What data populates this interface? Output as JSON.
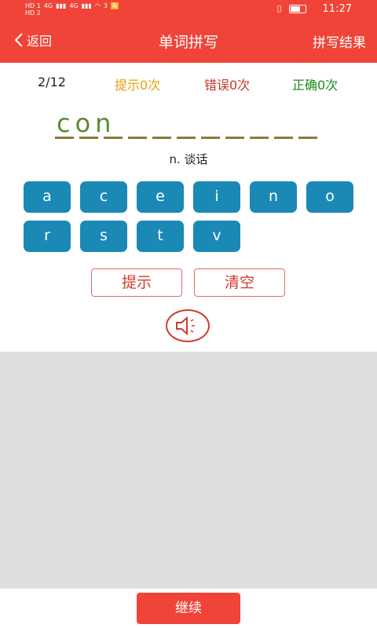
{
  "status_bar": {
    "left_items": [
      "HD 1",
      "4G",
      "HD 2",
      "4G",
      "3",
      "淘"
    ],
    "time": "11:27",
    "icons": [
      "hd-icon",
      "signal-icon",
      "wifi-icon",
      "vibrate-icon",
      "battery-icon"
    ]
  },
  "nav": {
    "back_label": "返回",
    "title": "单词拼写",
    "right_label": "拼写结果"
  },
  "stats": {
    "progress": "2/12",
    "hint_count": "提示0次",
    "error_count": "错误0次",
    "correct_count": "正确0次"
  },
  "word": {
    "typed": "con",
    "total_slots": 11,
    "meaning": "n. 谈话"
  },
  "letters": [
    "a",
    "c",
    "e",
    "i",
    "n",
    "o",
    "r",
    "s",
    "t",
    "v"
  ],
  "actions": {
    "hint_label": "提示",
    "clear_label": "清空"
  },
  "footer": {
    "continue_label": "继续"
  },
  "colors": {
    "primary": "#f04438",
    "key_bg": "#1a89b6",
    "hint_text": "#e6a10a",
    "error_text": "#c0392b",
    "correct_text": "#1c8a1c",
    "typed_letters": "#5e8a2e"
  }
}
